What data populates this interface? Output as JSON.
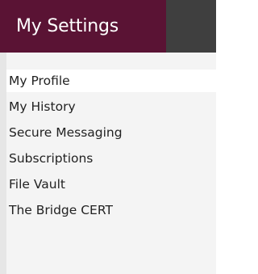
{
  "header": {
    "title": "My Settings"
  },
  "menu": {
    "items": [
      {
        "label": "My Profile",
        "active": true
      },
      {
        "label": "My History"
      },
      {
        "label": "Secure Messaging"
      },
      {
        "label": "Subscriptions"
      },
      {
        "label": "File Vault"
      },
      {
        "label": "The Bridge CERT"
      }
    ]
  },
  "colors": {
    "header_accent": "#5a1334",
    "header_bar": "#3f3f3f",
    "panel_background": "#f4f4f4",
    "active_item_background": "#ffffff",
    "text": "#222222"
  }
}
